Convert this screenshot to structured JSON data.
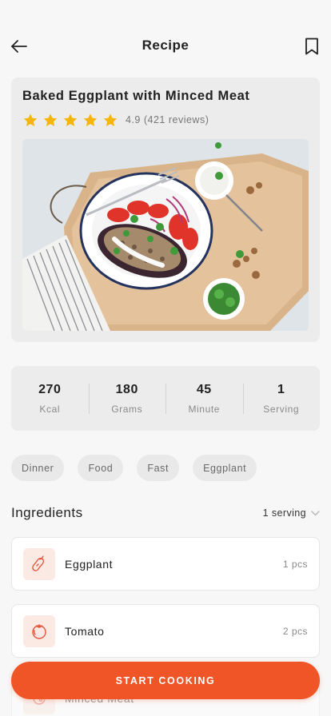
{
  "header": {
    "title": "Recipe",
    "back_icon": "arrow-left-icon",
    "bookmark_icon": "bookmark-icon"
  },
  "recipe": {
    "title": "Baked Eggplant with Minced Meat",
    "rating_stars": 5,
    "rating_text": "4.9 (421 reviews)",
    "star_color": "#F5B50A",
    "image_alt": "Baked eggplant topped with minced meat, tomatoes, onions and yogurt sauce on a plate"
  },
  "stats": [
    {
      "value": "270",
      "label": "Kcal"
    },
    {
      "value": "180",
      "label": "Grams"
    },
    {
      "value": "45",
      "label": "Minute"
    },
    {
      "value": "1",
      "label": "Serving"
    }
  ],
  "tags": [
    "Dinner",
    "Food",
    "Fast",
    "Eggplant"
  ],
  "ingredients": {
    "title": "Ingredients",
    "serving_selector": "1 serving",
    "items": [
      {
        "name": "Eggplant",
        "qty": "1 pcs",
        "icon": "eggplant-icon"
      },
      {
        "name": "Tomato",
        "qty": "2 pcs",
        "icon": "tomato-icon"
      },
      {
        "name": "Minced Meat",
        "qty": "",
        "icon": "meat-icon"
      }
    ]
  },
  "cta": {
    "label": "START COOKING"
  },
  "colors": {
    "accent": "#F05528",
    "card_bg": "#ECECEC",
    "page_bg": "#F7F7F7"
  }
}
